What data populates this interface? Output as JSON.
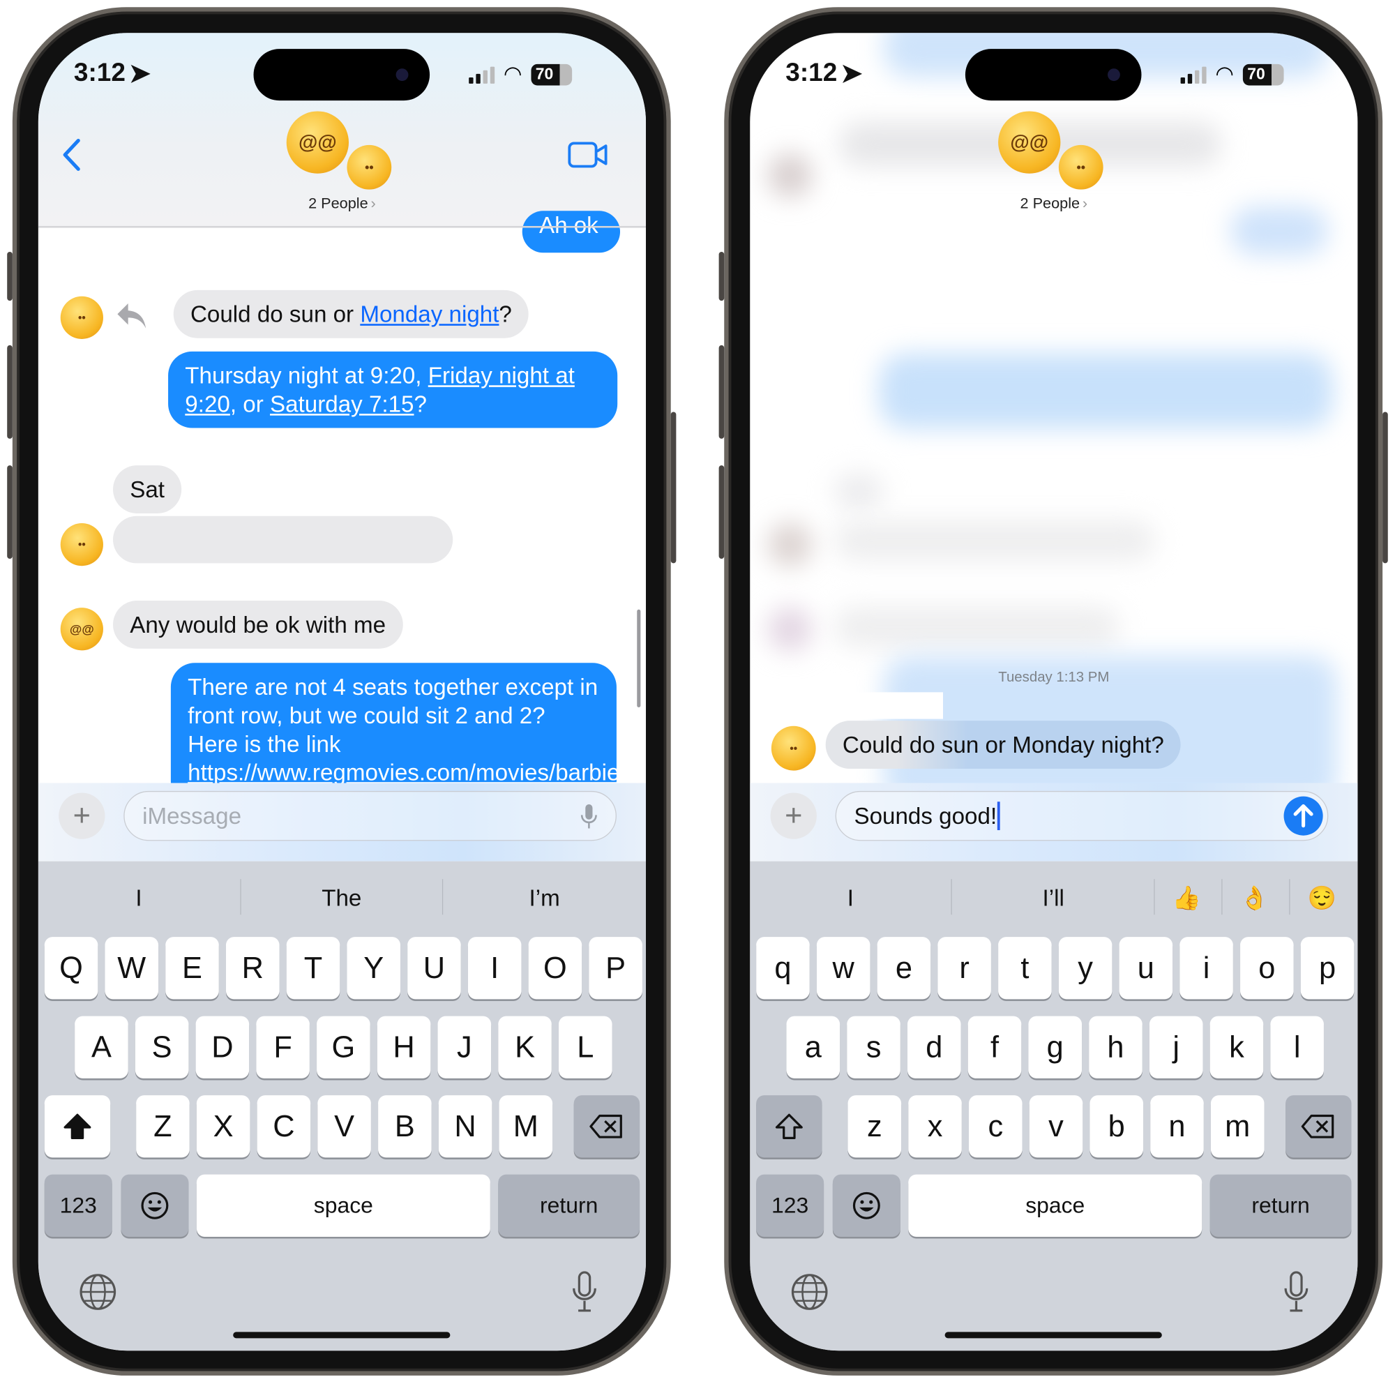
{
  "left_phone": {
    "status": {
      "time": "3:12",
      "battery": "70"
    },
    "header": {
      "group_label": "2 People",
      "chevron": "›",
      "back_icon": "chevron-left-icon",
      "video_icon": "video-camera-icon"
    },
    "messages": {
      "partial_top": "Ah ok",
      "msg1": [
        {
          "t": "Could do sun or "
        },
        {
          "t": "Monday night",
          "link": true
        },
        {
          "t": "?"
        }
      ],
      "msg2": [
        {
          "t": "Thursday night at 9:20, "
        },
        {
          "t": "Friday night at 9:20",
          "link": true
        },
        {
          "t": ", or "
        },
        {
          "t": "Saturday 7:15",
          "link": true
        },
        {
          "t": "?"
        }
      ],
      "msg3": [
        {
          "t": "Sat"
        }
      ],
      "msg4": [
        {
          "t": ""
        }
      ],
      "msg5": [
        {
          "t": "Any would be ok with me"
        }
      ],
      "msg6": [
        {
          "t": "There are not 4 seats together except in front row, but we could sit 2 and 2? Here is the link "
        },
        {
          "t": "https://www.regmovies.com/movies/barbie/",
          "link": true
        }
      ]
    },
    "input": {
      "placeholder": "iMessage",
      "value": ""
    },
    "keyboard": {
      "suggestions": [
        "I",
        "The",
        "I’m"
      ],
      "rows": [
        [
          "Q",
          "W",
          "E",
          "R",
          "T",
          "Y",
          "U",
          "I",
          "O",
          "P"
        ],
        [
          "A",
          "S",
          "D",
          "F",
          "G",
          "H",
          "J",
          "K",
          "L"
        ],
        [
          "Z",
          "X",
          "C",
          "V",
          "B",
          "N",
          "M"
        ]
      ],
      "numbers": "123",
      "space": "space",
      "return": "return",
      "shift_state": "on"
    }
  },
  "right_phone": {
    "status": {
      "time": "3:12",
      "battery": "70"
    },
    "header": {
      "group_label": "2 People",
      "chevron": "›"
    },
    "timestamp": "Tuesday 1:13 PM",
    "messages": {
      "msg1": [
        {
          "t": "Could do sun or "
        },
        {
          "t": "Monday night",
          "link": true
        },
        {
          "t": "?"
        }
      ]
    },
    "input": {
      "value": "Sounds good!"
    },
    "keyboard": {
      "suggestions": [
        "I",
        "I’ll",
        "👍",
        "👌",
        "😌"
      ],
      "rows": [
        [
          "q",
          "w",
          "e",
          "r",
          "t",
          "y",
          "u",
          "i",
          "o",
          "p"
        ],
        [
          "a",
          "s",
          "d",
          "f",
          "g",
          "h",
          "j",
          "k",
          "l"
        ],
        [
          "z",
          "x",
          "c",
          "v",
          "b",
          "n",
          "m"
        ]
      ],
      "numbers": "123",
      "space": "space",
      "return": "return",
      "shift_state": "off"
    }
  },
  "colors": {
    "accent": "#1a8cff",
    "link": "#0a66ff",
    "bubble_gray": "#e9e9eb",
    "keyboard_bg": "#d0d4db"
  }
}
